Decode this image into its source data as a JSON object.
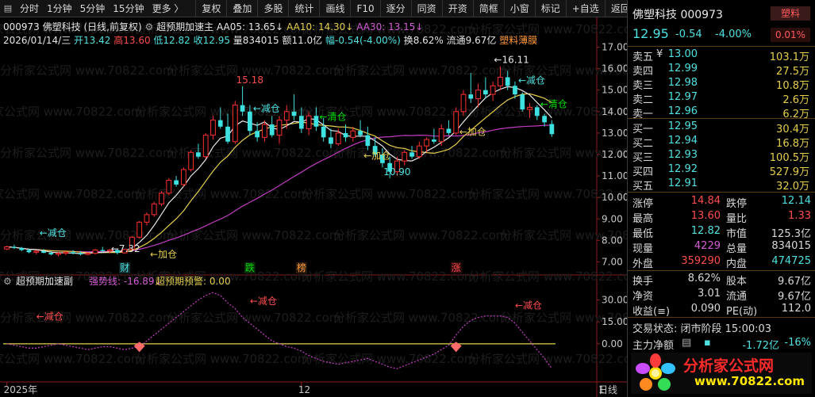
{
  "toolbar": {
    "left_buttons": [
      "分时",
      "1分钟",
      "5分钟",
      "15分钟",
      "更多 〉"
    ],
    "right_buttons": [
      "复权",
      "叠加",
      "多股",
      "统计",
      "画线",
      "F10",
      "逐分",
      "同资",
      "开资",
      "简框",
      "小窗",
      "标记",
      "+自选",
      "返回"
    ]
  },
  "chart_header": {
    "code": "000973",
    "name": "佛塑科技",
    "mode": "(日线,前复权)",
    "indicator_name": "超预期加速主",
    "aa05_label": "AA05: 13.65",
    "aa10_label": "AA10: 14.30",
    "aa30_label": "AA30: 13.15",
    "date": "2026/01/14/三",
    "open": "开13.42",
    "high": "高13.60",
    "low": "低12.82",
    "close": "收12.95",
    "volume": "量834015",
    "amount": "额11.0亿",
    "range": "幅-0.54(-4.00%)",
    "turnover": "换8.62%",
    "float": "流通9.67亿",
    "concept": "塑料薄膜"
  },
  "sub_header": {
    "name": "超预期加速副",
    "strength": "强势线: -16.89",
    "warning": "超预期预警: 0.00"
  },
  "chart_data": {
    "type": "candlestick",
    "ylim": [
      6.5,
      17.5
    ],
    "yticks": [
      7.0,
      8.0,
      9.0,
      10.0,
      11.0,
      12.0,
      13.0,
      14.0,
      15.0,
      16.0,
      17.0
    ],
    "sub_ylim": [
      -25,
      40
    ],
    "sub_yticks": [
      30.0,
      15.0,
      0.0
    ],
    "x_labels": [
      {
        "index": 0,
        "label": "2025年"
      },
      {
        "index": 40,
        "label": "12"
      },
      {
        "index": 81,
        "label": "1"
      },
      {
        "index": 94,
        "label": "日线"
      }
    ],
    "candles": [
      [
        7.6,
        7.75,
        7.55,
        7.7
      ],
      [
        7.7,
        7.8,
        7.6,
        7.65
      ],
      [
        7.65,
        7.7,
        7.5,
        7.55
      ],
      [
        7.55,
        7.6,
        7.4,
        7.45
      ],
      [
        7.45,
        7.55,
        7.35,
        7.5
      ],
      [
        7.5,
        7.6,
        7.4,
        7.42
      ],
      [
        7.42,
        7.5,
        7.3,
        7.35
      ],
      [
        7.35,
        7.45,
        7.25,
        7.4
      ],
      [
        7.4,
        7.5,
        7.32,
        7.45
      ],
      [
        7.45,
        7.55,
        7.35,
        7.4
      ],
      [
        7.4,
        7.5,
        7.3,
        7.35
      ],
      [
        7.35,
        7.45,
        7.3,
        7.4
      ],
      [
        7.4,
        7.6,
        7.35,
        7.55
      ],
      [
        7.55,
        7.7,
        7.45,
        7.5
      ],
      [
        7.5,
        7.6,
        7.4,
        7.55
      ],
      [
        7.55,
        7.6,
        7.35,
        7.42
      ],
      [
        7.42,
        7.6,
        7.38,
        7.58
      ],
      [
        7.58,
        8.2,
        7.55,
        8.15
      ],
      [
        8.15,
        8.9,
        8.1,
        8.85
      ],
      [
        8.85,
        9.3,
        8.7,
        9.2
      ],
      [
        9.2,
        9.8,
        9.1,
        9.7
      ],
      [
        9.7,
        10.3,
        9.6,
        10.2
      ],
      [
        10.2,
        10.9,
        10.1,
        10.8
      ],
      [
        10.8,
        11.0,
        10.5,
        10.6
      ],
      [
        10.6,
        11.4,
        10.5,
        11.3
      ],
      [
        11.3,
        12.2,
        11.2,
        12.1
      ],
      [
        12.1,
        12.5,
        11.8,
        11.9
      ],
      [
        11.9,
        13.0,
        11.8,
        12.9
      ],
      [
        12.9,
        13.8,
        12.7,
        13.6
      ],
      [
        13.6,
        14.2,
        13.2,
        13.3
      ],
      [
        13.3,
        13.9,
        12.5,
        12.6
      ],
      [
        12.6,
        14.5,
        12.5,
        14.3
      ],
      [
        14.3,
        15.18,
        13.8,
        14.0
      ],
      [
        14.0,
        14.3,
        12.9,
        13.1
      ],
      [
        13.1,
        13.5,
        12.6,
        12.8
      ],
      [
        12.8,
        13.6,
        12.6,
        13.4
      ],
      [
        13.4,
        13.8,
        12.8,
        12.9
      ],
      [
        12.9,
        13.8,
        12.5,
        13.6
      ],
      [
        13.6,
        14.3,
        13.2,
        14.0
      ],
      [
        14.0,
        14.8,
        13.6,
        13.8
      ],
      [
        13.8,
        14.2,
        13.0,
        13.2
      ],
      [
        13.2,
        14.0,
        12.9,
        13.8
      ],
      [
        13.8,
        14.2,
        13.1,
        13.3
      ],
      [
        13.3,
        13.7,
        12.6,
        12.8
      ],
      [
        12.8,
        13.2,
        12.3,
        12.5
      ],
      [
        12.5,
        13.2,
        12.4,
        13.0
      ],
      [
        13.0,
        13.4,
        12.6,
        12.8
      ],
      [
        12.8,
        13.3,
        12.6,
        13.1
      ],
      [
        13.1,
        13.6,
        12.8,
        12.9
      ],
      [
        12.9,
        13.3,
        12.2,
        12.4
      ],
      [
        12.4,
        12.8,
        11.9,
        12.0
      ],
      [
        12.0,
        12.3,
        11.4,
        11.6
      ],
      [
        11.6,
        11.9,
        10.9,
        11.2
      ],
      [
        11.2,
        11.9,
        11.0,
        11.7
      ],
      [
        11.7,
        12.2,
        11.5,
        12.1
      ],
      [
        12.1,
        12.4,
        11.8,
        11.9
      ],
      [
        11.9,
        12.6,
        11.8,
        12.4
      ],
      [
        12.4,
        12.8,
        12.1,
        12.7
      ],
      [
        12.7,
        13.2,
        12.5,
        12.6
      ],
      [
        12.6,
        13.4,
        12.4,
        13.2
      ],
      [
        13.2,
        13.6,
        12.9,
        13.0
      ],
      [
        13.0,
        14.2,
        12.9,
        14.0
      ],
      [
        14.0,
        15.0,
        13.8,
        14.8
      ],
      [
        14.8,
        15.8,
        14.4,
        14.6
      ],
      [
        14.6,
        15.3,
        14.2,
        15.0
      ],
      [
        15.0,
        15.6,
        14.6,
        14.8
      ],
      [
        14.8,
        15.4,
        14.5,
        15.2
      ],
      [
        15.2,
        16.11,
        15.0,
        15.6
      ],
      [
        15.6,
        15.9,
        15.0,
        15.2
      ],
      [
        15.2,
        15.4,
        14.6,
        14.8
      ],
      [
        14.8,
        14.9,
        14.0,
        14.1
      ],
      [
        14.1,
        14.4,
        13.7,
        14.2
      ],
      [
        14.2,
        14.3,
        13.6,
        13.8
      ],
      [
        13.8,
        13.9,
        13.3,
        13.5
      ],
      [
        13.42,
        13.6,
        12.82,
        12.95
      ]
    ],
    "annotations": [
      {
        "index": 32,
        "price": 15.18,
        "text": "15.18",
        "color": "#ff4d4d"
      },
      {
        "index": 15,
        "price": 7.32,
        "text": "←7.32",
        "color": "#e6e6e6"
      },
      {
        "index": 52,
        "price": 10.9,
        "text": "10.90",
        "color": "#4fe0e0"
      },
      {
        "index": 67,
        "price": 16.11,
        "text": "←16.11",
        "color": "#e6e6e6"
      }
    ],
    "signals": [
      {
        "index": 4,
        "price": 8.2,
        "text": "←减仓",
        "color": "#4fe0e0"
      },
      {
        "index": 19,
        "price": 7.2,
        "text": "←加仓",
        "color": "#e5cf4d"
      },
      {
        "index": 33,
        "price": 14.0,
        "text": "←减仓",
        "color": "#4fe0e0"
      },
      {
        "index": 42,
        "price": 13.6,
        "text": "←清仓",
        "color": "#00dd00"
      },
      {
        "index": 48,
        "price": 11.8,
        "text": "←加仓",
        "color": "#e5cf4d"
      },
      {
        "index": 61,
        "price": 12.9,
        "text": "←加仓",
        "color": "#e5cf4d"
      },
      {
        "index": 69,
        "price": 15.3,
        "text": "←减仓",
        "color": "#4fe0e0"
      },
      {
        "index": 72,
        "price": 14.2,
        "text": "←清仓",
        "color": "#00dd00"
      }
    ],
    "event_tags": [
      {
        "index": 16,
        "text": "财",
        "color": "#4fe0e0",
        "bg": "#102a2a"
      },
      {
        "index": 33,
        "text": "跌",
        "color": "#00dd00",
        "bg": "#0a2a0a"
      },
      {
        "index": 40,
        "text": "榜",
        "color": "#ff9a3c",
        "bg": "#2a1a08"
      },
      {
        "index": 61,
        "text": "涨",
        "color": "#ff4d4d",
        "bg": "#2a0a0a"
      }
    ],
    "sub_signals": [
      {
        "index": 4,
        "value": 16.5,
        "text": "←减仓",
        "color": "#ff4d4d"
      },
      {
        "index": 33,
        "value": 27,
        "text": "←减仓",
        "color": "#ff4d4d"
      },
      {
        "index": 69,
        "value": 24,
        "text": "←减仓",
        "color": "#ff4d4d"
      }
    ],
    "sub_markers": [
      {
        "index": 18,
        "value": -3,
        "color": "#ff6b6b"
      },
      {
        "index": 61,
        "value": -3,
        "color": "#ff6b6b"
      }
    ],
    "strength_line": [
      0,
      -1,
      -2,
      -3,
      -3,
      -2,
      -1,
      0,
      -1,
      -2,
      -3,
      -4,
      -3,
      -2,
      -2,
      -3,
      -4,
      -3,
      -2,
      2,
      6,
      10,
      14,
      18,
      22,
      26,
      30,
      33,
      35,
      33,
      28,
      24,
      18,
      14,
      10,
      6,
      2,
      0,
      -2,
      -3,
      -5,
      -8,
      -10,
      -12,
      -13,
      -14,
      -13,
      -12,
      -11,
      -10,
      -12,
      -14,
      -16,
      -17,
      -15,
      -13,
      -11,
      -9,
      -7,
      -4,
      -1,
      6,
      12,
      16,
      18,
      19,
      19,
      19,
      18,
      14,
      8,
      2,
      -4,
      -10,
      -16.89
    ],
    "warning_line": 0
  },
  "watermark": "分析家公式网 www.70822.com",
  "panel": {
    "name_code": "佛塑科技 000973",
    "sector_tag": "塑料",
    "price": "12.95",
    "change": "-0.54",
    "change_pct": "-4.00%",
    "ratio_tag": "0.01%",
    "asks": [
      {
        "label": "卖五",
        "extra": "¥",
        "price": "13.00",
        "volume": "103.1万"
      },
      {
        "label": "卖四",
        "extra": "",
        "price": "12.99",
        "volume": "27.5万"
      },
      {
        "label": "卖三",
        "extra": "",
        "price": "12.98",
        "volume": "10.8万"
      },
      {
        "label": "卖二",
        "extra": "",
        "price": "12.97",
        "volume": "2.6万"
      },
      {
        "label": "卖一",
        "extra": "",
        "price": "12.96",
        "volume": "6.2万"
      }
    ],
    "bids": [
      {
        "label": "买一",
        "extra": "",
        "price": "12.95",
        "volume": "30.4万"
      },
      {
        "label": "买二",
        "extra": "",
        "price": "12.94",
        "volume": "16.8万"
      },
      {
        "label": "买三",
        "extra": "",
        "price": "12.93",
        "volume": "100.5万"
      },
      {
        "label": "买四",
        "extra": "",
        "price": "12.92",
        "volume": "527.9万"
      },
      {
        "label": "买五",
        "extra": "",
        "price": "12.91",
        "volume": "32.0万"
      }
    ],
    "stats1": [
      {
        "l1": "涨停",
        "v1": "14.84",
        "c1": "#ff4d4d",
        "l2": "跌停",
        "v2": "12.14",
        "c2": "#4fe0e0"
      },
      {
        "l1": "最高",
        "v1": "13.60",
        "c1": "#ff4d4d",
        "l2": "量比",
        "v2": "1.33",
        "c2": "#ff4d4d"
      },
      {
        "l1": "最低",
        "v1": "12.82",
        "c1": "#4fe0e0",
        "l2": "市值",
        "v2": "125.3亿",
        "c2": "#d8d8d8"
      },
      {
        "l1": "现量",
        "v1": "4229",
        "c1": "#d45cd4",
        "l2": "总量",
        "v2": "834015",
        "c2": "#d8d8d8"
      },
      {
        "l1": "外盘",
        "v1": "359290",
        "c1": "#ff4d4d",
        "l2": "内盘",
        "v2": "474725",
        "c2": "#4fe0e0"
      }
    ],
    "stats2": [
      {
        "l1": "换手",
        "v1": "8.62%",
        "c1": "#d8d8d8",
        "l2": "股本",
        "v2": "9.67亿",
        "c2": "#d8d8d8"
      },
      {
        "l1": "净资",
        "v1": "3.01",
        "c1": "#d8d8d8",
        "l2": "流通",
        "v2": "9.67亿",
        "c2": "#d8d8d8"
      },
      {
        "l1": "收益(≡)",
        "v1": "0.090",
        "c1": "#d8d8d8",
        "l2": "PE(动)",
        "v2": "112.0",
        "c2": "#d8d8d8"
      }
    ],
    "status": "交易状态: 闭市阶段 15:00:03",
    "flow_label": "主力净额",
    "flow_value": "-1.72亿",
    "flow_pct": "-16%",
    "row5": "5日",
    "row14": "14",
    "logo_site": "分析家公式网",
    "logo_url": "www.70822.com"
  }
}
